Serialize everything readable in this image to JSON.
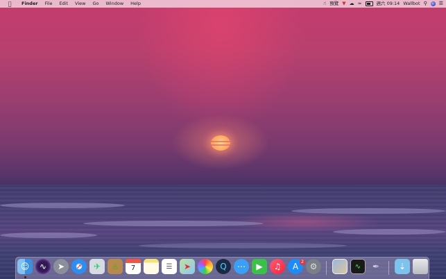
{
  "menubar": {
    "apple_icon": "apple-icon",
    "app_name": "Finder",
    "menus": [
      "File",
      "Edit",
      "View",
      "Go",
      "Window",
      "Help"
    ],
    "status": {
      "input_method": "預覽",
      "clock": "週六 09:14",
      "user": "Wallbot"
    }
  },
  "dock": {
    "items": [
      {
        "name": "finder",
        "icon": "finder-icon"
      },
      {
        "name": "siri",
        "icon": "siri-icon"
      },
      {
        "name": "launchpad",
        "icon": "rocket-icon"
      },
      {
        "name": "safari",
        "icon": "compass-icon"
      },
      {
        "name": "mail",
        "icon": "stamp-icon"
      },
      {
        "name": "contacts",
        "icon": "contacts-book-icon"
      },
      {
        "name": "calendar",
        "icon": "calendar-icon",
        "label": "7"
      },
      {
        "name": "notes",
        "icon": "notes-icon"
      },
      {
        "name": "reminders",
        "icon": "list-icon"
      },
      {
        "name": "maps",
        "icon": "map-icon"
      },
      {
        "name": "photos",
        "icon": "photos-flower-icon"
      },
      {
        "name": "quicktime",
        "icon": "quicktime-icon"
      },
      {
        "name": "messages",
        "icon": "speech-bubble-icon"
      },
      {
        "name": "facetime",
        "icon": "video-camera-icon"
      },
      {
        "name": "music",
        "icon": "music-note-icon"
      },
      {
        "name": "app-store",
        "icon": "app-store-icon",
        "badge": "2"
      },
      {
        "name": "system-preferences",
        "icon": "gear-icon"
      },
      {
        "name": "preview",
        "icon": "preview-photos-icon"
      },
      {
        "name": "activity-monitor",
        "icon": "monitor-icon"
      },
      {
        "name": "script-editor",
        "icon": "scroll-icon"
      },
      {
        "name": "downloads-folder",
        "icon": "folder-icon"
      },
      {
        "name": "trash",
        "icon": "trash-icon"
      }
    ]
  },
  "colors": {
    "menubar_bg": "#eec4d4",
    "sky_top": "#c43c6e",
    "sea": "#3c3866",
    "sun": "#ffc07a"
  }
}
